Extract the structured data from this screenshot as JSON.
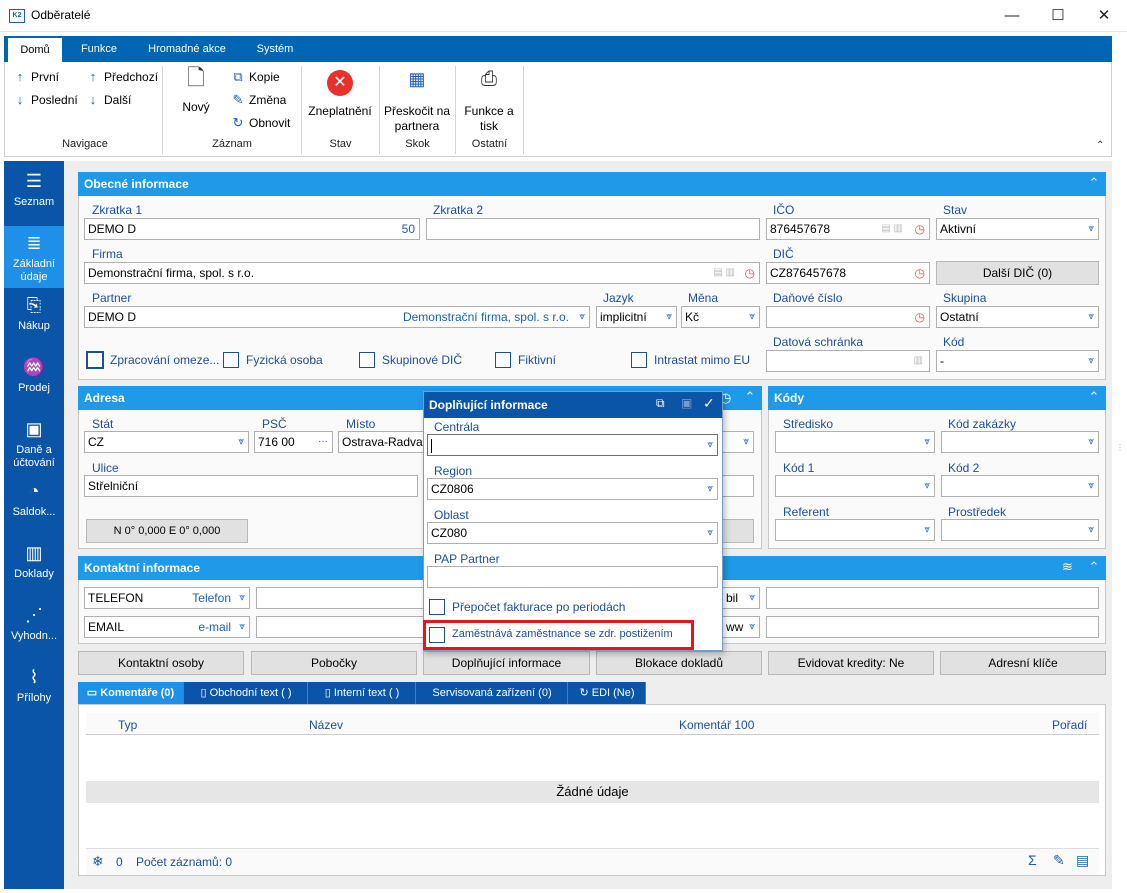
{
  "window": {
    "title": "Odběratelé",
    "app_icon": "K2",
    "minimize": "—",
    "maximize": "☐",
    "close": "✕"
  },
  "ribbon": {
    "tabs": [
      "Domů",
      "Funkce",
      "Hromadné akce",
      "Systém"
    ],
    "nav": {
      "first": "První",
      "last": "Poslední",
      "prev": "Předchozí",
      "next": "Další"
    },
    "record": {
      "new": "Nový",
      "copy": "Kopie",
      "edit": "Změna",
      "refresh": "Obnovit"
    },
    "invalidate": "Zneplatnění",
    "jump": "Přeskočit na partnera",
    "print": "Funkce a tisk",
    "groups": {
      "navigace": "Navigace",
      "zaznam": "Záznam",
      "stav": "Stav",
      "skok": "Skok",
      "ostatni": "Ostatní"
    }
  },
  "sidebar": {
    "items": [
      "Seznam",
      "Základní údaje",
      "Nákup",
      "Prodej",
      "Daně a účtování",
      "Saldok...",
      "Doklady",
      "Vyhodn...",
      "Přílohy"
    ]
  },
  "general": {
    "header": "Obecné informace",
    "zkratka1_label": "Zkratka 1",
    "zkratka1_value": "DEMO D",
    "zkratka1_num": "50",
    "zkratka2_label": "Zkratka 2",
    "zkratka2_value": "",
    "ico_label": "IČO",
    "ico_value": "876457678",
    "stav_label": "Stav",
    "stav_value": "Aktivní",
    "firma_label": "Firma",
    "firma_value": "Demonstrační firma, spol. s r.o.",
    "dic_label": "DIČ",
    "dic_value": "CZ876457678",
    "dalsi_dic": "Další DIČ (0)",
    "partner_label": "Partner",
    "partner_value": "DEMO D",
    "partner_name": "Demonstrační firma, spol. s r.o.",
    "jazyk_label": "Jazyk",
    "jazyk_value": "implicitní",
    "mena_label": "Měna",
    "mena_value": "Kč",
    "danove_label": "Daňové číslo",
    "danove_value": "",
    "skupina_label": "Skupina",
    "skupina_value": "Ostatní",
    "checks": [
      "Zpracování omeze...",
      "Fyzická osoba",
      "Skupinové DIČ",
      "Fiktivní",
      "Intrastat mimo EU"
    ],
    "datova_label": "Datová schránka",
    "datova_value": "",
    "kod_label": "Kód",
    "kod_value": "-"
  },
  "address": {
    "header": "Adresa",
    "stat_label": "Stát",
    "stat_value": "CZ",
    "psc_label": "PSČ",
    "psc_value": "716 00",
    "misto_label": "Místo",
    "misto_value": "Ostrava-Radva",
    "ulice_label": "Ulice",
    "ulice_value": "Střelniční",
    "gps": "N 0° 0,000 E 0° 0,000"
  },
  "codes": {
    "header": "Kódy",
    "stredisko": "Středisko",
    "zakazka": "Kód zakázky",
    "kod1": "Kód 1",
    "kod2": "Kód 2",
    "referent": "Referent",
    "prostredek": "Prostředek"
  },
  "contact": {
    "header": "Kontaktní informace",
    "rows": [
      {
        "name": "TELEFON",
        "type": "Telefon",
        "tail": "bil"
      },
      {
        "name": "EMAIL",
        "type": "e-mail",
        "tail": "ww"
      }
    ]
  },
  "actions": [
    "Kontaktní osoby",
    "Pobočky",
    "Doplňující informace",
    "Blokace dokladů",
    "Evidovat kredity: Ne",
    "Adresní klíče"
  ],
  "bottom_tabs": [
    "Komentáře (0)",
    "Obchodní text ( )",
    "Interní text ( )",
    "Servisovaná zařízení (0)",
    "EDI (Ne)"
  ],
  "grid": {
    "columns": [
      "Typ",
      "Název",
      "Komentář 100",
      "Pořadí"
    ],
    "empty": "Žádné údaje",
    "footer_count": "0",
    "footer_records": "Počet záznamů: 0"
  },
  "popup": {
    "title": "Doplňující informace",
    "centrala_label": "Centrála",
    "centrala_value": "",
    "region_label": "Region",
    "region_value": "CZ0806",
    "oblast_label": "Oblast",
    "oblast_value": "CZ080",
    "pap_label": "PAP Partner",
    "pap_value": "",
    "check1": "Přepočet fakturace po periodách",
    "check2": "Zaměstnává zaměstnance se zdr. postižením"
  },
  "colors": {
    "accent": "#1e9ae8",
    "nav": "#0a55a8",
    "highlight": "#e8141c"
  }
}
